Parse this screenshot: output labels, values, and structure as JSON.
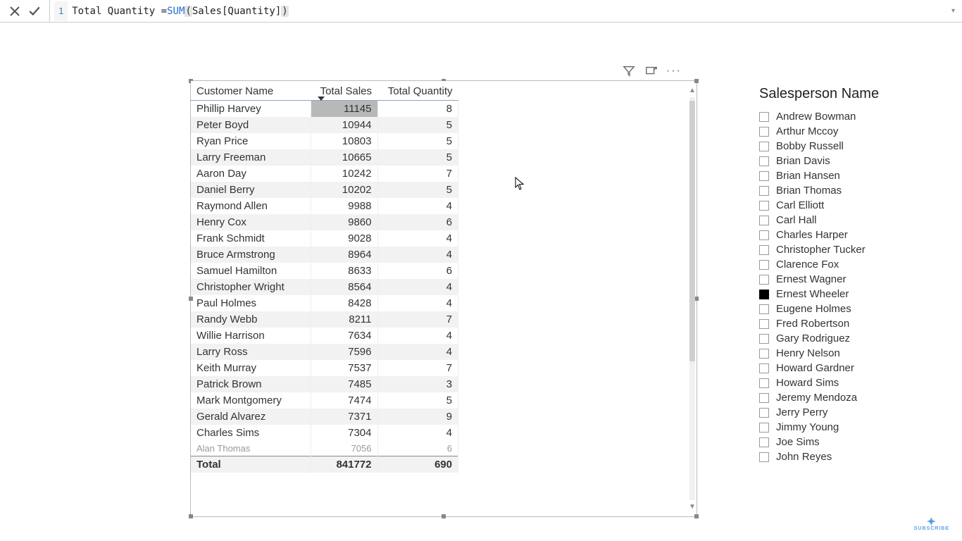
{
  "formula": {
    "line": "1",
    "prefix": "Total Quantity = ",
    "func": "SUM",
    "open": "(",
    "arg": " Sales[Quantity] ",
    "close": ")"
  },
  "visual_header": {
    "filter": "filter-icon",
    "focus": "focus-mode-icon",
    "more": "···"
  },
  "table": {
    "columns": [
      "Customer Name",
      "Total Sales",
      "Total Quantity"
    ],
    "sorted_col_index": 1,
    "rows": [
      {
        "name": "Phillip Harvey",
        "sales": 11145,
        "qty": 8,
        "selected": true
      },
      {
        "name": "Peter Boyd",
        "sales": 10944,
        "qty": 5
      },
      {
        "name": "Ryan Price",
        "sales": 10803,
        "qty": 5
      },
      {
        "name": "Larry Freeman",
        "sales": 10665,
        "qty": 5
      },
      {
        "name": "Aaron Day",
        "sales": 10242,
        "qty": 7
      },
      {
        "name": "Daniel Berry",
        "sales": 10202,
        "qty": 5
      },
      {
        "name": "Raymond Allen",
        "sales": 9988,
        "qty": 4
      },
      {
        "name": "Henry Cox",
        "sales": 9860,
        "qty": 6
      },
      {
        "name": "Frank Schmidt",
        "sales": 9028,
        "qty": 4
      },
      {
        "name": "Bruce Armstrong",
        "sales": 8964,
        "qty": 4
      },
      {
        "name": "Samuel Hamilton",
        "sales": 8633,
        "qty": 6
      },
      {
        "name": "Christopher Wright",
        "sales": 8564,
        "qty": 4
      },
      {
        "name": "Paul Holmes",
        "sales": 8428,
        "qty": 4
      },
      {
        "name": "Randy Webb",
        "sales": 8211,
        "qty": 7
      },
      {
        "name": "Willie Harrison",
        "sales": 7634,
        "qty": 4
      },
      {
        "name": "Larry Ross",
        "sales": 7596,
        "qty": 4
      },
      {
        "name": "Keith Murray",
        "sales": 7537,
        "qty": 7
      },
      {
        "name": "Patrick Brown",
        "sales": 7485,
        "qty": 3
      },
      {
        "name": "Mark Montgomery",
        "sales": 7474,
        "qty": 5
      },
      {
        "name": "Gerald Alvarez",
        "sales": 7371,
        "qty": 9
      },
      {
        "name": "Charles Sims",
        "sales": 7304,
        "qty": 4
      }
    ],
    "partial_row": {
      "name": "Alan Thomas",
      "sales": "7056",
      "qty": "6"
    },
    "total": {
      "label": "Total",
      "sales": 841772,
      "qty": 690
    }
  },
  "slicer": {
    "title": "Salesperson Name",
    "items": [
      {
        "label": "Andrew Bowman",
        "checked": false
      },
      {
        "label": "Arthur Mccoy",
        "checked": false
      },
      {
        "label": "Bobby Russell",
        "checked": false
      },
      {
        "label": "Brian Davis",
        "checked": false
      },
      {
        "label": "Brian Hansen",
        "checked": false
      },
      {
        "label": "Brian Thomas",
        "checked": false
      },
      {
        "label": "Carl Elliott",
        "checked": false
      },
      {
        "label": "Carl Hall",
        "checked": false
      },
      {
        "label": "Charles Harper",
        "checked": false
      },
      {
        "label": "Christopher Tucker",
        "checked": false
      },
      {
        "label": "Clarence Fox",
        "checked": false
      },
      {
        "label": "Ernest Wagner",
        "checked": false
      },
      {
        "label": "Ernest Wheeler",
        "checked": true
      },
      {
        "label": "Eugene Holmes",
        "checked": false
      },
      {
        "label": "Fred Robertson",
        "checked": false
      },
      {
        "label": "Gary Rodriguez",
        "checked": false
      },
      {
        "label": "Henry Nelson",
        "checked": false
      },
      {
        "label": "Howard Gardner",
        "checked": false
      },
      {
        "label": "Howard Sims",
        "checked": false
      },
      {
        "label": "Jeremy Mendoza",
        "checked": false
      },
      {
        "label": "Jerry Perry",
        "checked": false
      },
      {
        "label": "Jimmy Young",
        "checked": false
      },
      {
        "label": "Joe Sims",
        "checked": false
      },
      {
        "label": "John Reyes",
        "checked": false
      }
    ]
  },
  "subscribe": {
    "icon": "✦",
    "label": "SUBSCRIBE"
  }
}
